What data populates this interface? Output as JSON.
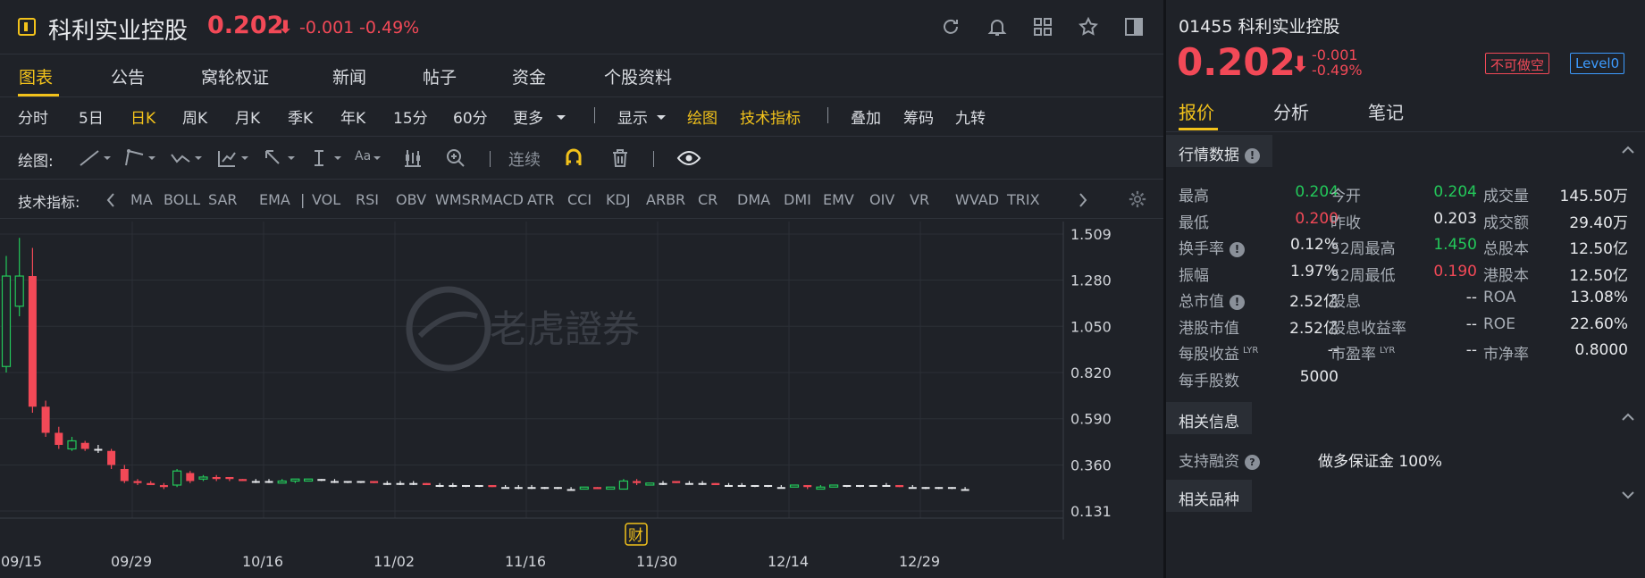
{
  "header": {
    "title": "科利实业控股",
    "price": "0.202",
    "arrow": "⬇",
    "change": "-0.001",
    "change_pct": "-0.49%"
  },
  "tabs": [
    "图表",
    "公告",
    "窝轮权证",
    "新闻",
    "帖子",
    "资金",
    "个股资料"
  ],
  "periods": {
    "items": [
      "分时",
      "5日",
      "日K",
      "周K",
      "月K",
      "季K",
      "年K",
      "15分",
      "60分",
      "更多"
    ],
    "active": "日K",
    "display": "显示",
    "draw": "绘图",
    "tech": "技术指标",
    "overlay": "叠加",
    "chips": "筹码",
    "nine": "九转"
  },
  "drawbar": {
    "label": "绘图:",
    "continuous": "连续",
    "aa": "Aa"
  },
  "indicators": {
    "label": "技术指标:",
    "items": [
      "MA",
      "BOLL",
      "SAR",
      "EMA",
      "|",
      "VOL",
      "RSI",
      "OBV",
      "WMSR",
      "MACD",
      "ATR",
      "CCI",
      "KDJ",
      "ARBR",
      "CR",
      "DMA",
      "DMI",
      "EMV",
      "OIV",
      "VR",
      "WVAD",
      "TRIX"
    ]
  },
  "chart_data": {
    "type": "candlestick",
    "y_ticks": [
      "1.509",
      "1.280",
      "1.050",
      "0.820",
      "0.590",
      "0.360",
      "0.131"
    ],
    "x_ticks": [
      "09/15",
      "09/29",
      "10/16",
      "11/02",
      "11/16",
      "11/30",
      "12/14",
      "12/29"
    ],
    "ylim": [
      0.131,
      1.509
    ],
    "watermark": "老虎證券",
    "event_marker": "财",
    "candles": [
      {
        "o": 0.85,
        "c": 1.3,
        "h": 1.4,
        "l": 0.82
      },
      {
        "o": 1.15,
        "c": 1.3,
        "h": 1.49,
        "l": 1.1
      },
      {
        "o": 1.3,
        "c": 0.65,
        "h": 1.44,
        "l": 0.62
      },
      {
        "o": 0.65,
        "c": 0.52,
        "h": 0.68,
        "l": 0.5
      },
      {
        "o": 0.52,
        "c": 0.46,
        "h": 0.55,
        "l": 0.44
      },
      {
        "o": 0.44,
        "c": 0.48,
        "h": 0.5,
        "l": 0.43
      },
      {
        "o": 0.47,
        "c": 0.44,
        "h": 0.48,
        "l": 0.43
      },
      {
        "o": 0.44,
        "c": 0.44,
        "h": 0.46,
        "l": 0.42
      },
      {
        "o": 0.43,
        "c": 0.36,
        "h": 0.44,
        "l": 0.34
      },
      {
        "o": 0.34,
        "c": 0.28,
        "h": 0.36,
        "l": 0.27
      },
      {
        "o": 0.28,
        "c": 0.27,
        "h": 0.29,
        "l": 0.26
      },
      {
        "o": 0.27,
        "c": 0.26,
        "h": 0.28,
        "l": 0.26
      },
      {
        "o": 0.26,
        "c": 0.25,
        "h": 0.27,
        "l": 0.24
      },
      {
        "o": 0.26,
        "c": 0.33,
        "h": 0.34,
        "l": 0.25
      },
      {
        "o": 0.32,
        "c": 0.28,
        "h": 0.33,
        "l": 0.27
      },
      {
        "o": 0.29,
        "c": 0.3,
        "h": 0.31,
        "l": 0.28
      },
      {
        "o": 0.3,
        "c": 0.29,
        "h": 0.31,
        "l": 0.28
      },
      {
        "o": 0.3,
        "c": 0.29,
        "h": 0.3,
        "l": 0.28
      },
      {
        "o": 0.29,
        "c": 0.28,
        "h": 0.29,
        "l": 0.28
      },
      {
        "o": 0.28,
        "c": 0.28,
        "h": 0.29,
        "l": 0.27
      },
      {
        "o": 0.28,
        "c": 0.28,
        "h": 0.29,
        "l": 0.27
      },
      {
        "o": 0.27,
        "c": 0.28,
        "h": 0.29,
        "l": 0.27
      },
      {
        "o": 0.28,
        "c": 0.29,
        "h": 0.29,
        "l": 0.27
      },
      {
        "o": 0.28,
        "c": 0.29,
        "h": 0.29,
        "l": 0.28
      },
      {
        "o": 0.29,
        "c": 0.29,
        "h": 0.29,
        "l": 0.28
      },
      {
        "o": 0.28,
        "c": 0.28,
        "h": 0.29,
        "l": 0.27
      },
      {
        "o": 0.28,
        "c": 0.28,
        "h": 0.28,
        "l": 0.27
      },
      {
        "o": 0.28,
        "c": 0.28,
        "h": 0.28,
        "l": 0.27
      },
      {
        "o": 0.28,
        "c": 0.27,
        "h": 0.28,
        "l": 0.27
      },
      {
        "o": 0.27,
        "c": 0.27,
        "h": 0.28,
        "l": 0.26
      },
      {
        "o": 0.27,
        "c": 0.27,
        "h": 0.28,
        "l": 0.26
      },
      {
        "o": 0.27,
        "c": 0.27,
        "h": 0.28,
        "l": 0.26
      },
      {
        "o": 0.27,
        "c": 0.26,
        "h": 0.27,
        "l": 0.26
      },
      {
        "o": 0.26,
        "c": 0.26,
        "h": 0.27,
        "l": 0.25
      },
      {
        "o": 0.26,
        "c": 0.26,
        "h": 0.27,
        "l": 0.25
      },
      {
        "o": 0.26,
        "c": 0.26,
        "h": 0.26,
        "l": 0.25
      },
      {
        "o": 0.26,
        "c": 0.26,
        "h": 0.26,
        "l": 0.25
      },
      {
        "o": 0.26,
        "c": 0.25,
        "h": 0.26,
        "l": 0.25
      },
      {
        "o": 0.25,
        "c": 0.25,
        "h": 0.26,
        "l": 0.25
      },
      {
        "o": 0.25,
        "c": 0.25,
        "h": 0.26,
        "l": 0.24
      },
      {
        "o": 0.25,
        "c": 0.25,
        "h": 0.26,
        "l": 0.24
      },
      {
        "o": 0.25,
        "c": 0.25,
        "h": 0.25,
        "l": 0.24
      },
      {
        "o": 0.25,
        "c": 0.25,
        "h": 0.25,
        "l": 0.24
      },
      {
        "o": 0.24,
        "c": 0.24,
        "h": 0.25,
        "l": 0.24
      },
      {
        "o": 0.24,
        "c": 0.25,
        "h": 0.25,
        "l": 0.24
      },
      {
        "o": 0.25,
        "c": 0.24,
        "h": 0.25,
        "l": 0.24
      },
      {
        "o": 0.24,
        "c": 0.25,
        "h": 0.25,
        "l": 0.24
      },
      {
        "o": 0.24,
        "c": 0.28,
        "h": 0.29,
        "l": 0.24
      },
      {
        "o": 0.28,
        "c": 0.27,
        "h": 0.29,
        "l": 0.26
      },
      {
        "o": 0.26,
        "c": 0.27,
        "h": 0.27,
        "l": 0.26
      },
      {
        "o": 0.27,
        "c": 0.27,
        "h": 0.28,
        "l": 0.26
      },
      {
        "o": 0.28,
        "c": 0.27,
        "h": 0.28,
        "l": 0.27
      },
      {
        "o": 0.27,
        "c": 0.27,
        "h": 0.28,
        "l": 0.27
      },
      {
        "o": 0.27,
        "c": 0.27,
        "h": 0.28,
        "l": 0.26
      },
      {
        "o": 0.27,
        "c": 0.26,
        "h": 0.27,
        "l": 0.26
      },
      {
        "o": 0.26,
        "c": 0.26,
        "h": 0.27,
        "l": 0.26
      },
      {
        "o": 0.26,
        "c": 0.26,
        "h": 0.27,
        "l": 0.26
      },
      {
        "o": 0.26,
        "c": 0.26,
        "h": 0.26,
        "l": 0.25
      },
      {
        "o": 0.26,
        "c": 0.26,
        "h": 0.26,
        "l": 0.25
      },
      {
        "o": 0.25,
        "c": 0.25,
        "h": 0.26,
        "l": 0.25
      },
      {
        "o": 0.25,
        "c": 0.26,
        "h": 0.26,
        "l": 0.25
      },
      {
        "o": 0.26,
        "c": 0.25,
        "h": 0.26,
        "l": 0.24
      },
      {
        "o": 0.24,
        "c": 0.25,
        "h": 0.26,
        "l": 0.24
      },
      {
        "o": 0.25,
        "c": 0.26,
        "h": 0.26,
        "l": 0.25
      },
      {
        "o": 0.26,
        "c": 0.26,
        "h": 0.26,
        "l": 0.25
      },
      {
        "o": 0.26,
        "c": 0.26,
        "h": 0.26,
        "l": 0.25
      },
      {
        "o": 0.26,
        "c": 0.26,
        "h": 0.26,
        "l": 0.26
      },
      {
        "o": 0.26,
        "c": 0.26,
        "h": 0.27,
        "l": 0.26
      },
      {
        "o": 0.26,
        "c": 0.25,
        "h": 0.26,
        "l": 0.25
      },
      {
        "o": 0.25,
        "c": 0.25,
        "h": 0.26,
        "l": 0.25
      },
      {
        "o": 0.25,
        "c": 0.25,
        "h": 0.25,
        "l": 0.24
      },
      {
        "o": 0.25,
        "c": 0.25,
        "h": 0.25,
        "l": 0.24
      },
      {
        "o": 0.25,
        "c": 0.25,
        "h": 0.25,
        "l": 0.24
      },
      {
        "o": 0.24,
        "c": 0.24,
        "h": 0.25,
        "l": 0.24
      }
    ]
  },
  "right": {
    "code_name": "01455 科利实业控股",
    "price": "0.202",
    "arrow": "⬇",
    "change": "-0.001",
    "change_pct": "-0.49%",
    "tag_short": "不可做空",
    "tag_level": "Level0",
    "tabs": [
      "报价",
      "分析",
      "笔记"
    ],
    "section_market": "行情数据",
    "section_related": "相关信息",
    "section_products": "相关品种",
    "margin_label": "支持融资",
    "margin_value": "做多保证金 100%",
    "col1": [
      {
        "label": "最高",
        "value": "0.204",
        "color": "green"
      },
      {
        "label": "最低",
        "value": "0.200",
        "color": "red"
      },
      {
        "label": "换手率",
        "value": "0.12%",
        "info": true
      },
      {
        "label": "振幅",
        "value": "1.97%"
      },
      {
        "label": "总市值",
        "value": "2.52亿",
        "info": true
      },
      {
        "label": "港股市值",
        "value": "2.52亿"
      },
      {
        "label": "每股收益",
        "value": "--",
        "sup": "LYR"
      },
      {
        "label": "每手股数",
        "value": "5000"
      }
    ],
    "col2": [
      {
        "label": "今开",
        "value": "0.204",
        "color": "green"
      },
      {
        "label": "昨收",
        "value": "0.203"
      },
      {
        "label": "52周最高",
        "value": "1.450",
        "color": "green"
      },
      {
        "label": "52周最低",
        "value": "0.190",
        "color": "red"
      },
      {
        "label": "股息",
        "value": "--"
      },
      {
        "label": "股息收益率",
        "value": "--"
      },
      {
        "label": "市盈率",
        "value": "--",
        "sup": "LYR"
      }
    ],
    "col3": [
      {
        "label": "成交量",
        "value": "145.50万"
      },
      {
        "label": "成交额",
        "value": "29.40万"
      },
      {
        "label": "总股本",
        "value": "12.50亿"
      },
      {
        "label": "港股本",
        "value": "12.50亿"
      },
      {
        "label": "ROA",
        "value": "13.08%"
      },
      {
        "label": "ROE",
        "value": "22.60%"
      },
      {
        "label": "市净率",
        "value": "0.8000"
      }
    ]
  }
}
